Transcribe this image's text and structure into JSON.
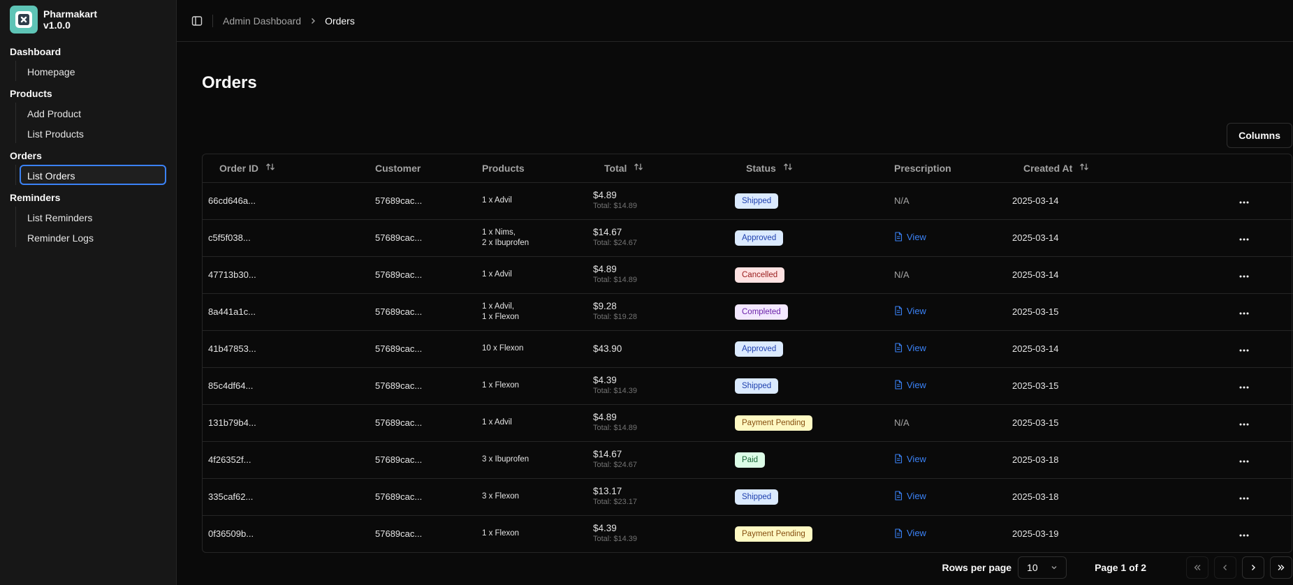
{
  "app": {
    "name": "Pharmakart",
    "version": "v1.0.0"
  },
  "sidebar": {
    "groups": [
      {
        "label": "Dashboard",
        "items": [
          {
            "label": "Homepage",
            "active": false
          }
        ]
      },
      {
        "label": "Products",
        "items": [
          {
            "label": "Add Product",
            "active": false
          },
          {
            "label": "List Products",
            "active": false
          }
        ]
      },
      {
        "label": "Orders",
        "items": [
          {
            "label": "List Orders",
            "active": true
          }
        ]
      },
      {
        "label": "Reminders",
        "items": [
          {
            "label": "List Reminders",
            "active": false
          },
          {
            "label": "Reminder Logs",
            "active": false
          }
        ]
      }
    ]
  },
  "breadcrumb": {
    "parent": "Admin Dashboard",
    "current": "Orders"
  },
  "page": {
    "title": "Orders",
    "columns_button": "Columns"
  },
  "table": {
    "headers": {
      "order_id": "Order ID",
      "customer": "Customer",
      "products": "Products",
      "total": "Total",
      "status": "Status",
      "prescription": "Prescription",
      "created_at": "Created At"
    },
    "rows": [
      {
        "order_id": "66cd646a...",
        "customer": "57689cac...",
        "products": [
          "1 x Advil"
        ],
        "total": "$4.89",
        "total_sub": "Total: $14.89",
        "status": "Shipped",
        "prescription": "N/A",
        "created_at": "2025-03-14"
      },
      {
        "order_id": "c5f5f038...",
        "customer": "57689cac...",
        "products": [
          "1 x Nims,",
          "2 x Ibuprofen"
        ],
        "total": "$14.67",
        "total_sub": "Total: $24.67",
        "status": "Approved",
        "prescription": "View",
        "created_at": "2025-03-14"
      },
      {
        "order_id": "47713b30...",
        "customer": "57689cac...",
        "products": [
          "1 x Advil"
        ],
        "total": "$4.89",
        "total_sub": "Total: $14.89",
        "status": "Cancelled",
        "prescription": "N/A",
        "created_at": "2025-03-14"
      },
      {
        "order_id": "8a441a1c...",
        "customer": "57689cac...",
        "products": [
          "1 x Advil,",
          "1 x Flexon"
        ],
        "total": "$9.28",
        "total_sub": "Total: $19.28",
        "status": "Completed",
        "prescription": "View",
        "created_at": "2025-03-15"
      },
      {
        "order_id": "41b47853...",
        "customer": "57689cac...",
        "products": [
          "10 x Flexon"
        ],
        "total": "$43.90",
        "total_sub": "",
        "status": "Approved",
        "prescription": "View",
        "created_at": "2025-03-14"
      },
      {
        "order_id": "85c4df64...",
        "customer": "57689cac...",
        "products": [
          "1 x Flexon"
        ],
        "total": "$4.39",
        "total_sub": "Total: $14.39",
        "status": "Shipped",
        "prescription": "View",
        "created_at": "2025-03-15"
      },
      {
        "order_id": "131b79b4...",
        "customer": "57689cac...",
        "products": [
          "1 x Advil"
        ],
        "total": "$4.89",
        "total_sub": "Total: $14.89",
        "status": "Payment Pending",
        "prescription": "N/A",
        "created_at": "2025-03-15"
      },
      {
        "order_id": "4f26352f...",
        "customer": "57689cac...",
        "products": [
          "3 x Ibuprofen"
        ],
        "total": "$14.67",
        "total_sub": "Total: $24.67",
        "status": "Paid",
        "prescription": "View",
        "created_at": "2025-03-18"
      },
      {
        "order_id": "335caf62...",
        "customer": "57689cac...",
        "products": [
          "3 x Flexon"
        ],
        "total": "$13.17",
        "total_sub": "Total: $23.17",
        "status": "Shipped",
        "prescription": "View",
        "created_at": "2025-03-18"
      },
      {
        "order_id": "0f36509b...",
        "customer": "57689cac...",
        "products": [
          "1 x Flexon"
        ],
        "total": "$4.39",
        "total_sub": "Total: $14.39",
        "status": "Payment Pending",
        "prescription": "View",
        "created_at": "2025-03-19"
      }
    ]
  },
  "status_colors": {
    "Shipped": {
      "bg": "#dbeafe",
      "fg": "#1e40af"
    },
    "Approved": {
      "bg": "#dbeafe",
      "fg": "#1e40af"
    },
    "Cancelled": {
      "bg": "#fee2e2",
      "fg": "#991b1b"
    },
    "Completed": {
      "bg": "#f3e8ff",
      "fg": "#6b21a8"
    },
    "Payment Pending": {
      "bg": "#fef9c3",
      "fg": "#854d0e"
    },
    "Paid": {
      "bg": "#dcfce7",
      "fg": "#166534"
    }
  },
  "pagination": {
    "rows_per_page_label": "Rows per page",
    "rows_per_page": "10",
    "page_info": "Page 1 of 2"
  },
  "icons": {
    "sort": "sort-icon",
    "view": "file-text-icon",
    "more": "more-horizontal-icon",
    "sidebar_toggle": "panel-left-icon",
    "chevron_right": "chevron-right-icon",
    "chevron_down": "chevron-down-icon",
    "first_page": "chevrons-left-icon",
    "prev_page": "chevron-left-icon",
    "next_page": "chevron-right-icon",
    "last_page": "chevrons-right-icon"
  },
  "accent": "#3b82f6"
}
